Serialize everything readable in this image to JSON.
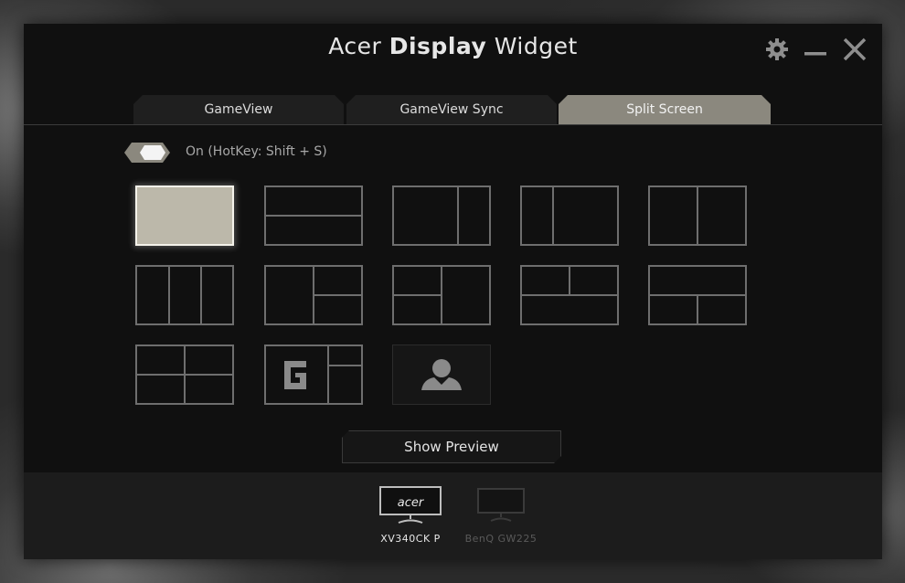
{
  "window": {
    "title_prefix": "Acer",
    "title_bold": "Display",
    "title_suffix": "Widget",
    "controls": [
      "gear-icon",
      "minimize-icon",
      "close-icon"
    ]
  },
  "tabs": [
    {
      "label": "GameView",
      "active": false
    },
    {
      "label": "GameView Sync",
      "active": false
    },
    {
      "label": "Split Screen",
      "active": true
    }
  ],
  "split_screen": {
    "toggle": {
      "state": "on",
      "label": "On (HotKey: Shift + S)"
    },
    "layouts": [
      {
        "name": "layout-single",
        "selected": true
      },
      {
        "name": "layout-two-rows"
      },
      {
        "name": "layout-large-left-narrow-right"
      },
      {
        "name": "layout-narrow-left-large-right"
      },
      {
        "name": "layout-two-columns"
      },
      {
        "name": "layout-three-columns"
      },
      {
        "name": "layout-left-right-split"
      },
      {
        "name": "layout-left-split-right"
      },
      {
        "name": "layout-top-split-bottom"
      },
      {
        "name": "layout-top-bottom-split"
      },
      {
        "name": "layout-quad"
      },
      {
        "name": "layout-gameview-split",
        "glyph": "G"
      },
      {
        "name": "layout-person",
        "icon": "person-icon"
      }
    ],
    "preview_button": "Show Preview"
  },
  "monitors": [
    {
      "logo": "acer",
      "label": "XV340CK P",
      "active": true
    },
    {
      "label": "BenQ GW225",
      "active": false
    }
  ],
  "colors": {
    "accent_tab": "#8b887e",
    "selected_layout": "#bcb8aa",
    "window_bg": "#101010",
    "bottom_bar": "#1c1c1c"
  }
}
